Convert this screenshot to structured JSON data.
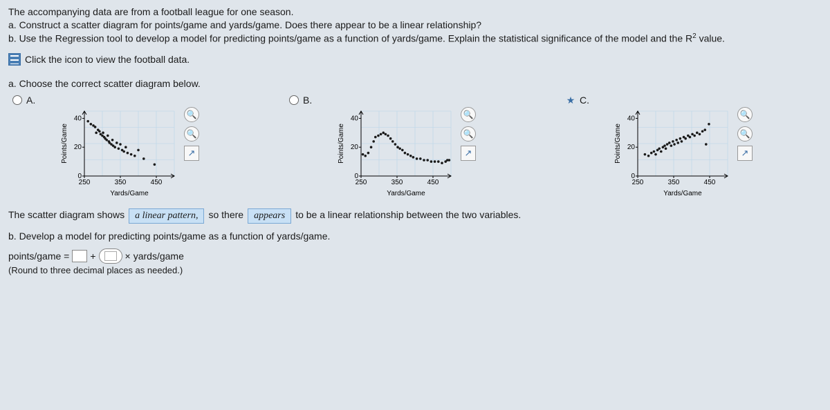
{
  "intro": {
    "line1": "The accompanying data are from a football league for one season.",
    "line_a": "a. Construct a scatter diagram for points/game and yards/game. Does there appear to be a linear relationship?",
    "line_b": "b. Use the Regression tool to develop a model for predicting points/game as a function of yards/game. Explain the statistical significance of the model and the R",
    "line_b_sup": "2",
    "line_b_tail": " value."
  },
  "data_link": "Click the icon to view the football data.",
  "question_a": "a. Choose the correct scatter diagram below.",
  "choices": {
    "a": {
      "label": "A."
    },
    "b": {
      "label": "B."
    },
    "c": {
      "label": "C.",
      "selected": true
    }
  },
  "axis": {
    "xlabel": "Yards/Game",
    "ylabel": "Points/Game",
    "xticks": [
      "250",
      "350",
      "450"
    ],
    "yticks": [
      "0",
      "20",
      "40"
    ]
  },
  "chart_data": [
    {
      "name": "A",
      "type": "scatter",
      "xlabel": "Yards/Game",
      "ylabel": "Points/Game",
      "xlim": [
        250,
        500
      ],
      "ylim": [
        0,
        45
      ],
      "series": [
        {
          "name": "teams",
          "points": [
            [
              260,
              38
            ],
            [
              268,
              36
            ],
            [
              275,
              35
            ],
            [
              280,
              34
            ],
            [
              283,
              30
            ],
            [
              288,
              32
            ],
            [
              292,
              31
            ],
            [
              295,
              29
            ],
            [
              300,
              28
            ],
            [
              302,
              30
            ],
            [
              305,
              27
            ],
            [
              308,
              26
            ],
            [
              312,
              25
            ],
            [
              315,
              28
            ],
            [
              318,
              24
            ],
            [
              320,
              23
            ],
            [
              325,
              22
            ],
            [
              328,
              25
            ],
            [
              330,
              21
            ],
            [
              335,
              20
            ],
            [
              340,
              23
            ],
            [
              345,
              19
            ],
            [
              350,
              22
            ],
            [
              355,
              18
            ],
            [
              360,
              17
            ],
            [
              365,
              20
            ],
            [
              370,
              16
            ],
            [
              380,
              15
            ],
            [
              390,
              14
            ],
            [
              400,
              18
            ],
            [
              415,
              12
            ],
            [
              445,
              8
            ]
          ]
        }
      ]
    },
    {
      "name": "B",
      "type": "scatter",
      "xlabel": "Yards/Game",
      "ylabel": "Points/Game",
      "xlim": [
        250,
        500
      ],
      "ylim": [
        0,
        45
      ],
      "series": [
        {
          "name": "teams",
          "points": [
            [
              255,
              15
            ],
            [
              262,
              14
            ],
            [
              270,
              16
            ],
            [
              278,
              20
            ],
            [
              285,
              24
            ],
            [
              290,
              27
            ],
            [
              298,
              28
            ],
            [
              305,
              29
            ],
            [
              312,
              30
            ],
            [
              318,
              29
            ],
            [
              325,
              28
            ],
            [
              332,
              26
            ],
            [
              338,
              24
            ],
            [
              345,
              22
            ],
            [
              352,
              20
            ],
            [
              358,
              19
            ],
            [
              365,
              18
            ],
            [
              372,
              16
            ],
            [
              380,
              15
            ],
            [
              388,
              14
            ],
            [
              395,
              13
            ],
            [
              405,
              12
            ],
            [
              415,
              12
            ],
            [
              425,
              11
            ],
            [
              435,
              11
            ],
            [
              445,
              10
            ],
            [
              455,
              10
            ],
            [
              465,
              10
            ],
            [
              475,
              9
            ],
            [
              485,
              10
            ],
            [
              490,
              11
            ],
            [
              495,
              11
            ]
          ]
        }
      ]
    },
    {
      "name": "C",
      "type": "scatter",
      "xlabel": "Yards/Game",
      "ylabel": "Points/Game",
      "xlim": [
        250,
        500
      ],
      "ylim": [
        0,
        45
      ],
      "series": [
        {
          "name": "teams",
          "points": [
            [
              270,
              15
            ],
            [
              280,
              14
            ],
            [
              288,
              16
            ],
            [
              295,
              17
            ],
            [
              300,
              15
            ],
            [
              305,
              18
            ],
            [
              310,
              19
            ],
            [
              315,
              17
            ],
            [
              320,
              20
            ],
            [
              325,
              21
            ],
            [
              328,
              19
            ],
            [
              332,
              22
            ],
            [
              338,
              23
            ],
            [
              343,
              21
            ],
            [
              348,
              24
            ],
            [
              352,
              22
            ],
            [
              358,
              25
            ],
            [
              362,
              23
            ],
            [
              368,
              26
            ],
            [
              372,
              24
            ],
            [
              378,
              27
            ],
            [
              383,
              26
            ],
            [
              390,
              28
            ],
            [
              395,
              27
            ],
            [
              402,
              29
            ],
            [
              408,
              28
            ],
            [
              415,
              30
            ],
            [
              422,
              29
            ],
            [
              430,
              31
            ],
            [
              437,
              32
            ],
            [
              440,
              22
            ],
            [
              448,
              36
            ]
          ]
        }
      ]
    }
  ],
  "sentence": {
    "s1": "The scatter diagram shows",
    "ans1": "a linear pattern,",
    "s2": "so there",
    "ans2": "appears",
    "s3": "to be a linear relationship between the two variables."
  },
  "part_b": "b. Develop a model for predicting points/game as a function of yards/game.",
  "equation": {
    "lhs": "points/game =",
    "plus": "+",
    "times": "×",
    "rhs": "yards/game"
  },
  "round": "(Round to three decimal places as needed.)"
}
